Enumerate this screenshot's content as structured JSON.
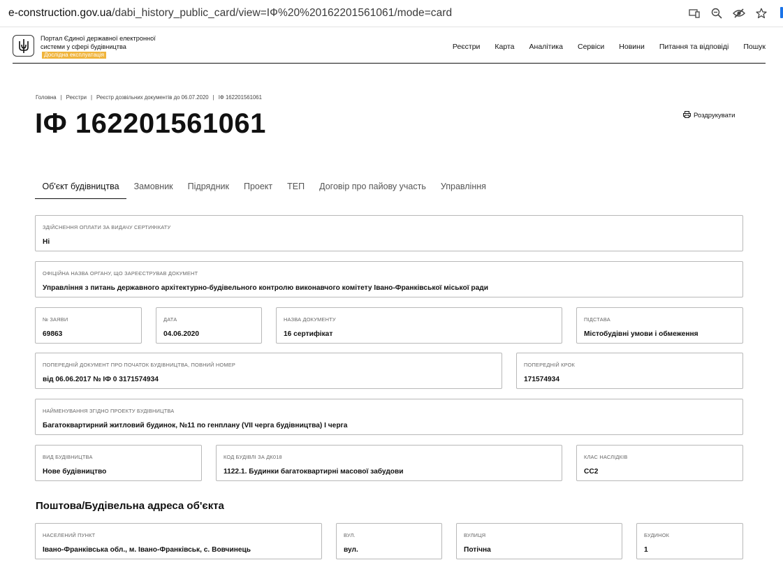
{
  "browser": {
    "url_host": "e-construction.gov.ua",
    "url_path": "/dabi_history_public_card/view=ІФ%20%20162201561061/mode=card"
  },
  "header": {
    "portal_title": "Портал Єдиної державної електронної системи у сфері будівництва",
    "badge": "Дослідна експлуатація",
    "nav": [
      "Реєстри",
      "Карта",
      "Аналітика",
      "Сервіси",
      "Новини",
      "Питання та відповіді",
      "Пошук"
    ]
  },
  "breadcrumb": [
    "Головна",
    "Реєстри",
    "Реєстр дозвільних документів до 06.07.2020",
    "ІФ 162201561061"
  ],
  "page_title": "ІФ 162201561061",
  "print_label": "Роздрукувати",
  "tabs": [
    "Об'єкт будівництва",
    "Замовник",
    "Підрядник",
    "Проект",
    "ТЕП",
    "Договір про пайову участь",
    "Управління"
  ],
  "fields": {
    "payment": {
      "label": "Здійснення оплати за видачу сертифікату",
      "value": "Ні"
    },
    "authority": {
      "label": "Офіційна назва органу, що зареєстрував документ",
      "value": "Управління з питань державного архітектурно-будівельного контролю виконавчого комітету Івано-Франківської міської ради"
    },
    "app_no": {
      "label": "№ заяви",
      "value": "69863"
    },
    "date": {
      "label": "Дата",
      "value": "04.06.2020"
    },
    "doc_name": {
      "label": "Назва документу",
      "value": "16 сертифікат"
    },
    "basis": {
      "label": "Підстава",
      "value": "Містобудівні умови і обмеження"
    },
    "prev_doc": {
      "label": "Попередній документ про початок будівництва, повний номер",
      "value": "від 06.06.2017 № ІФ 0 3171574934"
    },
    "prev_step": {
      "label": "Попередній крок",
      "value": "171574934"
    },
    "project_name": {
      "label": "Найменування згідно проекту будівництва",
      "value": "Багатоквартирний житловий будинок, №11 по генплану (VII черга будівництва) І черга"
    },
    "construction_type": {
      "label": "Вид будівництва",
      "value": "Нове будівництво"
    },
    "building_code": {
      "label": "Код будівлі за ДК018",
      "value": "1122.1. Будинки багатоквартирні масової забудови"
    },
    "consequence_class": {
      "label": "Клас наслідків",
      "value": "СС2"
    }
  },
  "address_title": "Поштова/Будівельна адреса об'єкта",
  "address": {
    "locality": {
      "label": "Населений пункт",
      "value": "Івано-Франківська обл., м. Івано-Франківськ, с. Вовчинець"
    },
    "street_type": {
      "label": "Вул.",
      "value": "вул."
    },
    "street": {
      "label": "Вулиця",
      "value": "Потічна"
    },
    "building": {
      "label": "Будинок",
      "value": "1"
    }
  }
}
